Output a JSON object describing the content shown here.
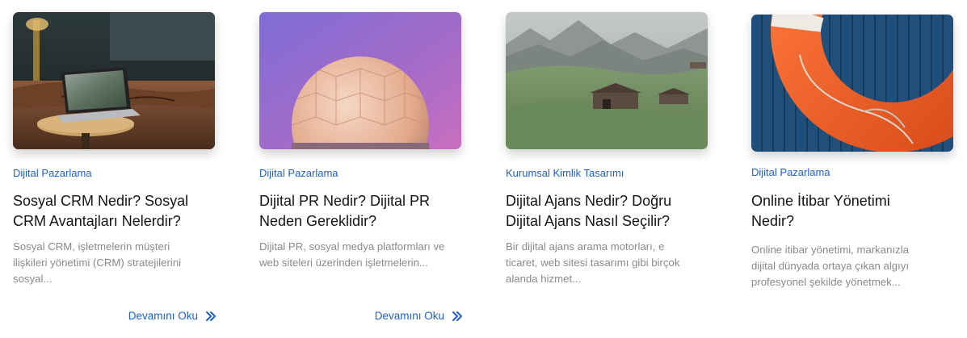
{
  "posts": [
    {
      "category": "Dijital Pazarlama",
      "title_lines": [
        "Sosyal CRM Nedir? Sosyal",
        "CRM Avantajları Nelerdir?"
      ],
      "excerpt_lines": [
        "Sosyal CRM, işletmelerin müşteri",
        "ilişkileri yönetimi (CRM) stratejilerini",
        "sosyal..."
      ],
      "read_more": "Devamını Oku",
      "image_icon": "laptop-lounge-photo"
    },
    {
      "category": "Dijital Pazarlama",
      "title_lines": [
        "Dijital PR Nedir? Dijital PR",
        "Neden Gereklidir?"
      ],
      "excerpt_lines": [
        "Dijital PR, sosyal medya platformları ve",
        "web siteleri üzerinden işletmelerin..."
      ],
      "read_more": "Devamını Oku",
      "image_icon": "radome-photo"
    },
    {
      "category": "Kurumsal Kimlik Tasarımı",
      "title_lines": [
        "Dijital Ajans Nedir? Doğru",
        "Dijital Ajans Nasıl Seçilir?"
      ],
      "excerpt_lines": [
        "Bir dijital ajans arama motorları, e",
        "ticaret, web sitesi tasarımı gibi birçok",
        "alanda hizmet..."
      ],
      "image_icon": "mountain-huts-photo"
    },
    {
      "category": "Dijital Pazarlama",
      "title_lines": [
        "Online İtibar Yönetimi",
        "Nedir?"
      ],
      "excerpt_lines": [
        "Online itibar yönetimi, markanızla",
        "dijital dünyada ortaya çıkan algıyı",
        "profesyonel şekilde yönetmek..."
      ],
      "image_icon": "lifebuoy-photo"
    }
  ],
  "colors": {
    "accent": "#1f5fd6",
    "title": "#15131a",
    "excerpt": "#8a8a8a"
  }
}
